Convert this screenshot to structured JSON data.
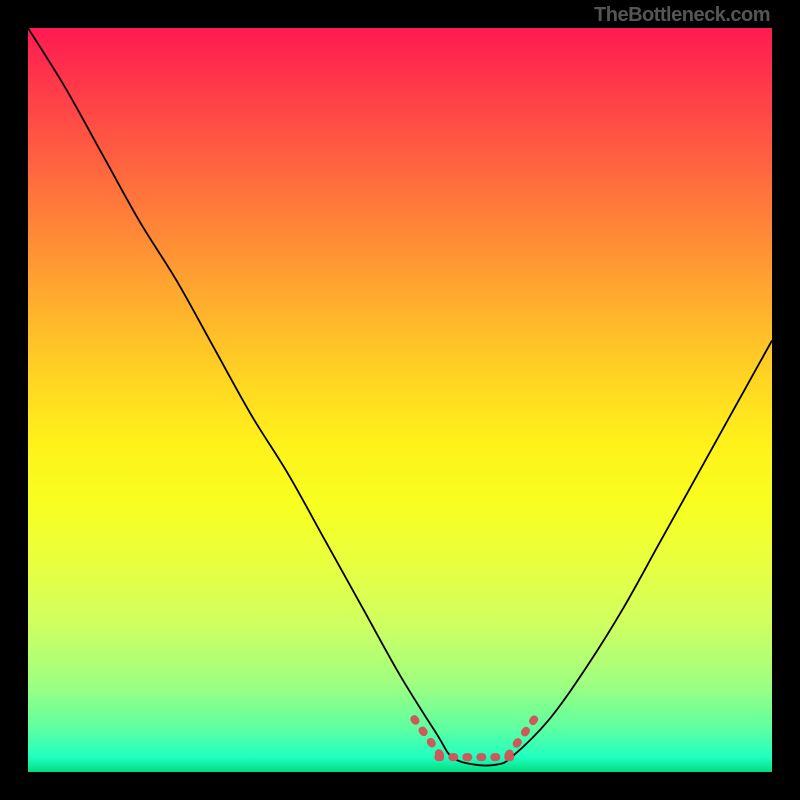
{
  "attribution": "TheBottleneck.com",
  "chart_data": {
    "type": "line",
    "title": "",
    "xlabel": "",
    "ylabel": "",
    "xlim": [
      0,
      100
    ],
    "ylim": [
      0,
      100
    ],
    "x": [
      0,
      5,
      10,
      15,
      20,
      25,
      30,
      35,
      40,
      45,
      50,
      55,
      57,
      60,
      63,
      65,
      70,
      75,
      80,
      85,
      90,
      95,
      100
    ],
    "values": [
      100,
      92,
      83,
      74,
      66,
      57,
      48,
      40,
      31,
      22,
      13,
      5,
      2,
      1,
      1,
      2,
      7,
      14,
      22,
      31,
      40,
      49,
      58
    ],
    "tolerance_band": {
      "x_start": 53,
      "x_end": 67,
      "y": 2
    },
    "grid": false,
    "legend": false
  }
}
